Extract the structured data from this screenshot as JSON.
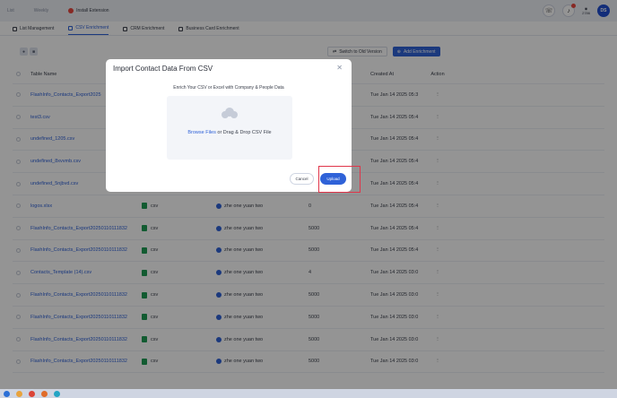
{
  "topbar": {
    "crumbs": [
      "List",
      "Weekly"
    ],
    "extension_label": "Install Extension",
    "credits_label": "2786",
    "logo_text": "DS"
  },
  "tabs": [
    {
      "label": "List Management",
      "active": false
    },
    {
      "label": "CSV Enrichment",
      "active": true
    },
    {
      "label": "CRM Enrichment",
      "active": false
    },
    {
      "label": "Business Card Enrichment",
      "active": false
    }
  ],
  "toolbar": {
    "switch_label": "Switch to Old Version",
    "add_label": "Add Enrichment"
  },
  "table": {
    "headers": {
      "name": "Table Name",
      "created": "Created At",
      "action": "Action"
    },
    "rows": [
      {
        "name": "FlashInfo_Contacts_Export2025",
        "type": "",
        "owner": "",
        "records": "",
        "created": "Tue Jan 14 2025 05:3",
        "action": "⋮"
      },
      {
        "name": "test3.csv",
        "type": "",
        "owner": "",
        "records": "",
        "created": "Tue Jan 14 2025 05:4",
        "action": "⋮"
      },
      {
        "name": "undefined_1205.csv",
        "type": "",
        "owner": "",
        "records": "",
        "created": "Tue Jan 14 2025 05:4",
        "action": "⋮"
      },
      {
        "name": "undefined_8xvvmb.csv",
        "type": "",
        "owner": "",
        "records": "",
        "created": "Tue Jan 14 2025 05:4",
        "action": "⋮"
      },
      {
        "name": "undefined_5njbvd.csv",
        "type": "",
        "owner": "",
        "records": "",
        "created": "Tue Jan 14 2025 05:4",
        "action": "⋮"
      },
      {
        "name": "logos.xlsx",
        "type": "csv",
        "owner": "zhe one yuan two",
        "records": "0",
        "created": "Tue Jan 14 2025 05:4",
        "action": "⋮"
      },
      {
        "name": "FlashInfo_Contacts_Export20250110111832",
        "type": "csv",
        "owner": "zhe one yuan two",
        "records": "5000",
        "created": "Tue Jan 14 2025 05:4",
        "action": "⋮"
      },
      {
        "name": "FlashInfo_Contacts_Export20250110111832",
        "type": "csv",
        "owner": "zhe one yuan two",
        "records": "5000",
        "created": "Tue Jan 14 2025 05:4",
        "action": "⋮"
      },
      {
        "name": "Contacts_Template (14).csv",
        "type": "csv",
        "owner": "zhe one yuan two",
        "records": "4",
        "created": "Tue Jan 14 2025 03:0",
        "action": "⋮"
      },
      {
        "name": "FlashInfo_Contacts_Export20250110111832",
        "type": "csv",
        "owner": "zhe one yuan two",
        "records": "5000",
        "created": "Tue Jan 14 2025 03:0",
        "action": "⋮"
      },
      {
        "name": "FlashInfo_Contacts_Export20250110111832",
        "type": "csv",
        "owner": "zhe one yuan two",
        "records": "5000",
        "created": "Tue Jan 14 2025 03:0",
        "action": "⋮"
      },
      {
        "name": "FlashInfo_Contacts_Export20250110111832",
        "type": "csv",
        "owner": "zhe one yuan two",
        "records": "5000",
        "created": "Tue Jan 14 2025 03:0",
        "action": "⋮"
      },
      {
        "name": "FlashInfo_Contacts_Export20250110111832",
        "type": "csv",
        "owner": "zhe one yuan two",
        "records": "5000",
        "created": "Tue Jan 14 2025 03:0",
        "action": "⋮"
      }
    ]
  },
  "modal": {
    "title": "Import Contact Data From CSV",
    "close_glyph": "✕",
    "subtitle": "Enrich Your CSV or Excel with Company & People Data",
    "browse_link": "Browse Files",
    "dropzone_text": " or Drag & Drop CSV File",
    "cancel_label": "Cancel",
    "upload_label": "Upload"
  },
  "colors": {
    "accent": "#2f62d8",
    "highlight": "#e0354a",
    "file_icon": "#1f9d55"
  }
}
